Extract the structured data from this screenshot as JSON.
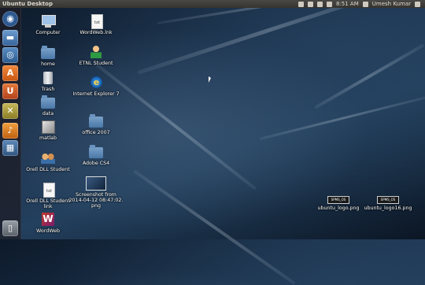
{
  "topbar": {
    "title": "Ubuntu Desktop",
    "time": "8:51 AM",
    "user": "Umesh Kumar"
  },
  "launcher": {
    "items": [
      "dash-home",
      "files",
      "chromium",
      "ubuntu-software",
      "settings",
      "ubuntu-one",
      "workspaces",
      "trash"
    ]
  },
  "desktop": {
    "computer": "Computer",
    "home": "home",
    "trash": "Trash",
    "data": "data",
    "matlab": "matlab",
    "orell1": "Orell DLL Student",
    "orell2a": "Orell DLL Student",
    "orell2b": "link",
    "wordweb": "WordWeb",
    "wordweb_link": "WordWeb.lnk",
    "etnl": "ETNL Student",
    "ie": "Internet Explorer 7",
    "office": "office 2007",
    "adobe": "Adobe CS4",
    "shot1": "Screenshot from",
    "shot2": "2014-04-12 08:47:02.",
    "shot3": "png",
    "logo1": "ubuntu_logo.png",
    "logo2": "ubuntu_logo16.png",
    "logo_badge": "SPMS_OS",
    "txt_badge": "txt"
  }
}
